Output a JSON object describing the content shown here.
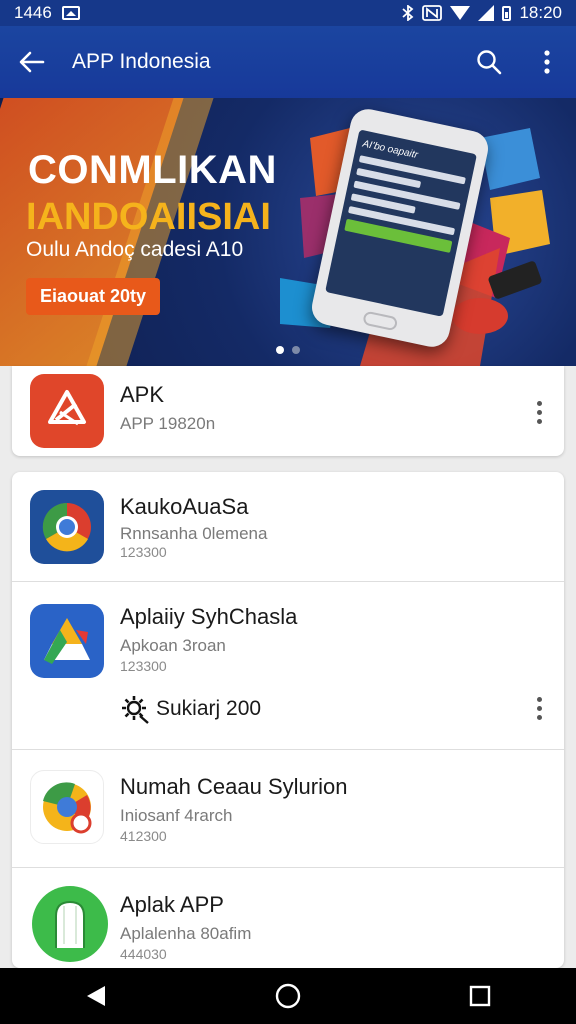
{
  "status_bar": {
    "time_left": "1446",
    "time_right": "18:20"
  },
  "app_bar": {
    "title": "APP Indonesia"
  },
  "banner": {
    "headline": "CONMLIKAN",
    "headline2": "IANDOAIISIAI",
    "subline": "Oulu Andoç cadesi A10",
    "cta": "Eiaouat 20ty",
    "phone_title": "AI’bo oapaitr",
    "slides": 2,
    "active_slide": 1
  },
  "apps": [
    {
      "name": "APK",
      "subtitle": "APP 19820n",
      "size": ""
    },
    {
      "name": "KaukoAuaSa",
      "subtitle": "Rnnsanha 0lemena",
      "size": "123300"
    },
    {
      "name": "Aplaiiy SyhChasla",
      "subtitle": "Apkoan 3roan",
      "size": "123300",
      "action_label": "Sukiarj 200"
    },
    {
      "name": "Numah Ceaau Sylurion",
      "subtitle": "Iniosanf 4rarch",
      "size": "412300"
    },
    {
      "name": "Aplak APP",
      "subtitle": "Aplalenha 80afim",
      "size": "444030"
    }
  ],
  "colors": {
    "app_bar": "#1b45a0",
    "accent_orange": "#e8591a",
    "accent_yellow": "#f5b31c"
  }
}
